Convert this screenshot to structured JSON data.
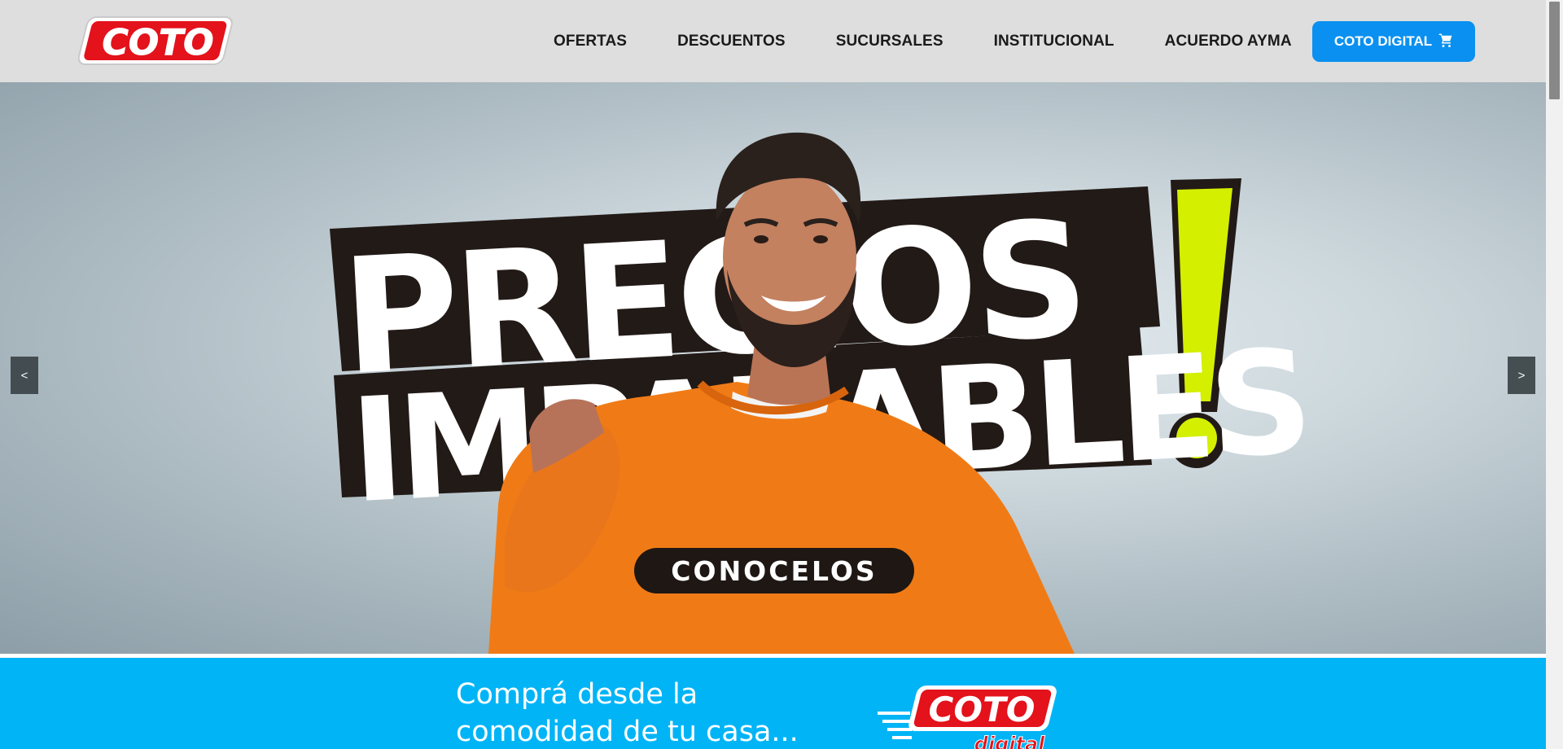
{
  "header": {
    "logo_text": "COTO",
    "nav": [
      {
        "label": "OFERTAS"
      },
      {
        "label": "DESCUENTOS"
      },
      {
        "label": "SUCURSALES"
      },
      {
        "label": "INSTITUCIONAL"
      },
      {
        "label": "ACUERDO AYMA"
      }
    ],
    "cta_label": "COTO DIGITAL",
    "cta_icon": "shopping-cart-icon"
  },
  "hero": {
    "headline_line1": "PRECIOS",
    "headline_line2": "IMPARABLES",
    "exclamation": "!",
    "button_label": "CONOCELOS",
    "prev_label": "<",
    "next_label": ">"
  },
  "digital_banner": {
    "text_line1": "Comprá desde la",
    "text_line2": "comodidad de tu casa...",
    "logo_text": "COTO",
    "logo_subtext": "digital"
  },
  "colors": {
    "brand_red": "#e3121b",
    "cta_blue": "#0a90f0",
    "banner_blue": "#00b4f6",
    "header_gray": "#dedede",
    "accent_lime": "#d4ef00",
    "sweater_orange": "#f07b16"
  }
}
